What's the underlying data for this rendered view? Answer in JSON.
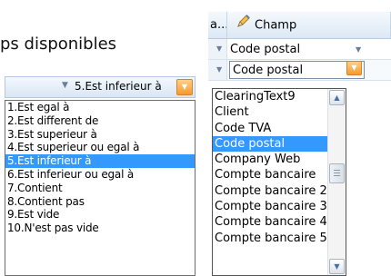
{
  "heading": "ps disponibles",
  "operator_filter": {
    "selected_value": "5.Est inferieur à",
    "options": [
      "1.Est egal à",
      "2.Est different de",
      "3.Est superieur à",
      "4.Est superieur ou egal à",
      "5.Est inferieur à",
      "6.Est inferieur ou egal à",
      "7.Contient",
      "8.Contient pas",
      "9.Est vide",
      "10.N'est pas vide"
    ],
    "selected_index": 4
  },
  "grid": {
    "col_a_header": "a...",
    "col_champ_header": "Champ",
    "row1_value": "Code postal",
    "row2_value": "Code postal"
  },
  "field_dropdown": {
    "options": [
      "ClearingText9",
      "Client",
      "Code TVA",
      "Code postal",
      "Company Web",
      "Compte bancaire",
      "Compte bancaire 2",
      "Compte bancaire 3",
      "Compte bancaire 4",
      "Compte bancaire 5"
    ],
    "selected_index": 3
  },
  "colors": {
    "selection": "#3399ff",
    "dropdown_button": "#f49a2b",
    "header": "#dce8f5"
  }
}
